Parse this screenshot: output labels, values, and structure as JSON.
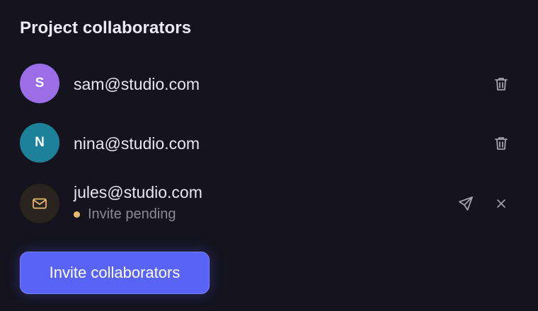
{
  "panel": {
    "title": "Project collaborators"
  },
  "collaborators": [
    {
      "initial": "S",
      "email": "sam@studio.com",
      "avatar_color": "#9b6ee8",
      "action_icon": "trash-icon"
    },
    {
      "initial": "N",
      "email": "nina@studio.com",
      "avatar_color": "#1d8199",
      "action_icon": "trash-icon"
    }
  ],
  "pending": {
    "email": "jules@studio.com",
    "status": "Invite pending",
    "avatar_icon": "mail-icon",
    "avatar_color": "#2a2420",
    "icon_color": "#e9b872",
    "dot_color": "#e9b872",
    "actions": [
      "send-icon",
      "close-icon"
    ]
  },
  "invite_button": {
    "label": "Invite collaborators",
    "color": "#5964f7"
  },
  "colors": {
    "background": "#14131e",
    "icon": "#a3a2ae"
  }
}
